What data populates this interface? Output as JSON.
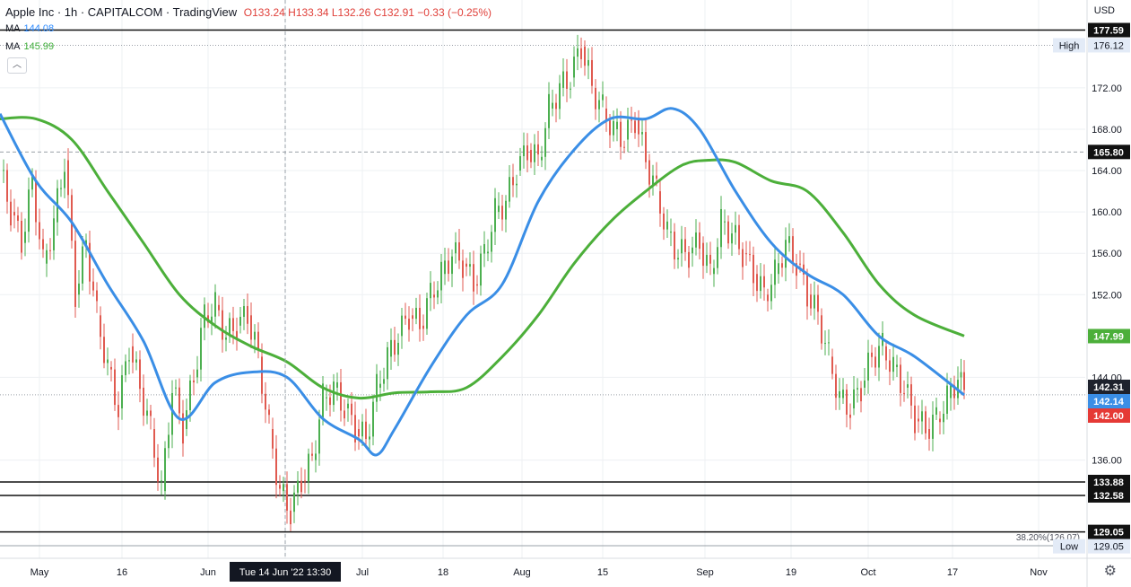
{
  "header": {
    "title": "Apple Inc · 1h · CAPITALCOM · TradingView",
    "ohlc": "O133.24 H133.34 L132.26 C132.91 −0.33 (−0.25%)",
    "ma1_label": "MA",
    "ma1_value": "144.08",
    "ma2_label": "MA",
    "ma2_value": "145.99",
    "collapse_icon": "chevron-up-icon"
  },
  "axis": {
    "currency": "USD",
    "y_ticks": [
      "172.00",
      "168.00",
      "164.00",
      "160.00",
      "156.00",
      "152.00",
      "144.00",
      "136.00"
    ],
    "x_ticks": [
      "May",
      "16",
      "Jun",
      "Jul",
      "18",
      "Aug",
      "15",
      "Sep",
      "19",
      "Oct",
      "17",
      "Nov"
    ],
    "crosshair_time": "Tue 14 Jun '22   13:30",
    "settings_icon": "gear-icon"
  },
  "colors": {
    "ma_fast": "#3a8ee6",
    "ma_slow": "#4caf3a",
    "candle_up": "#4caf50",
    "candle_down": "#e05a50",
    "price_current": "#e53935"
  },
  "chart_data": {
    "type": "candlestick-line",
    "symbol": "Apple Inc",
    "interval": "1h",
    "source": "CAPITALCOM",
    "ylim": [
      126.5,
      180.5
    ],
    "x_months": [
      "May",
      "Jun",
      "Jul",
      "Aug",
      "Sep",
      "Oct",
      "Nov"
    ],
    "ma_fast": {
      "value": "144.08",
      "x": [
        0,
        40,
        80,
        120,
        160,
        200,
        240,
        280,
        320,
        360,
        400,
        420,
        440,
        480,
        520,
        560,
        600,
        640,
        680,
        720,
        750,
        780,
        820,
        860,
        900,
        940,
        980,
        1020,
        1075
      ],
      "y": [
        169.5,
        163,
        159,
        153,
        147.5,
        140,
        143.5,
        144.5,
        144,
        140,
        138,
        136.5,
        139,
        145,
        150,
        153,
        161,
        166,
        169,
        169,
        170,
        168,
        162,
        157,
        154,
        152,
        148,
        146,
        142.3
      ]
    },
    "ma_slow": {
      "value": "145.99",
      "x": [
        0,
        40,
        80,
        120,
        160,
        200,
        240,
        280,
        320,
        360,
        400,
        440,
        480,
        520,
        560,
        600,
        640,
        680,
        720,
        760,
        790,
        820,
        860,
        900,
        940,
        980,
        1020,
        1075
      ],
      "y": [
        169,
        169,
        167,
        162,
        157,
        152,
        149,
        147,
        145.5,
        143,
        142,
        142.5,
        142.6,
        143,
        146,
        150,
        155,
        159,
        162,
        164.5,
        165,
        164.8,
        163,
        162,
        158,
        153,
        150,
        148
      ]
    },
    "levels": [
      {
        "value": 177.59,
        "label": "177.59",
        "style": "solid"
      },
      {
        "value": 176.12,
        "label": "176.12",
        "tag": "High",
        "style": "dotted"
      },
      {
        "value": 165.8,
        "label": "165.80",
        "style": "dashed"
      },
      {
        "value": 142.31,
        "label": "142.31",
        "style": "dotted"
      },
      {
        "value": 133.88,
        "label": "133.88",
        "style": "solid"
      },
      {
        "value": 132.58,
        "label": "132.58",
        "style": "solid"
      },
      {
        "value": 129.05,
        "label": "129.05",
        "style": "solid"
      },
      {
        "value": 129.05,
        "label": "129.05",
        "tag": "Low",
        "style": "none"
      }
    ],
    "price_tags": [
      {
        "value": 147.99,
        "label": "147.99",
        "color": "#4caf3a"
      },
      {
        "value": 142.31,
        "label": "142.31",
        "color": "#1e222d"
      },
      {
        "value": 142.14,
        "label": "142.14",
        "color": "#3a8ee6"
      },
      {
        "value": 142.0,
        "label": "142.00",
        "color": "#e53935"
      }
    ],
    "fib_label": "38.20%(126.07)",
    "candles": {
      "x": [
        0,
        12,
        24,
        36,
        48,
        60,
        72,
        84,
        96,
        108,
        120,
        132,
        144,
        156,
        168,
        180,
        192,
        204,
        216,
        228,
        240,
        252,
        264,
        276,
        288,
        300,
        312,
        324,
        336,
        348,
        360,
        372,
        384,
        396,
        408,
        420,
        432,
        444,
        456,
        468,
        480,
        492,
        504,
        516,
        528,
        540,
        552,
        564,
        576,
        588,
        600,
        612,
        624,
        636,
        648,
        660,
        672,
        684,
        696,
        708,
        720,
        732,
        744,
        756,
        768,
        780,
        792,
        804,
        816,
        828,
        840,
        852,
        864,
        876,
        888,
        900,
        912,
        924,
        936,
        948,
        960,
        972,
        984,
        996,
        1008,
        1020,
        1032,
        1044,
        1056,
        1068,
        1075
      ],
      "y": [
        164,
        160,
        157,
        163,
        155,
        159,
        165,
        152,
        157,
        150,
        145,
        141,
        147,
        143,
        139,
        133,
        143,
        139,
        144,
        150,
        151,
        148,
        149,
        150,
        146,
        139,
        133,
        131,
        134,
        136,
        142,
        143,
        141,
        139,
        138,
        143,
        146,
        148,
        150,
        149,
        152,
        154,
        156,
        155,
        153,
        156,
        160,
        161,
        164,
        166,
        165,
        170,
        172,
        173,
        176,
        172,
        170,
        168,
        167,
        169,
        165,
        162,
        158,
        156,
        156,
        157,
        154,
        159,
        158,
        156,
        154,
        152,
        154,
        157,
        155,
        152,
        150,
        146,
        142,
        141,
        143,
        146,
        147,
        145,
        143,
        140,
        139,
        140,
        142,
        144,
        142.3
      ]
    }
  }
}
